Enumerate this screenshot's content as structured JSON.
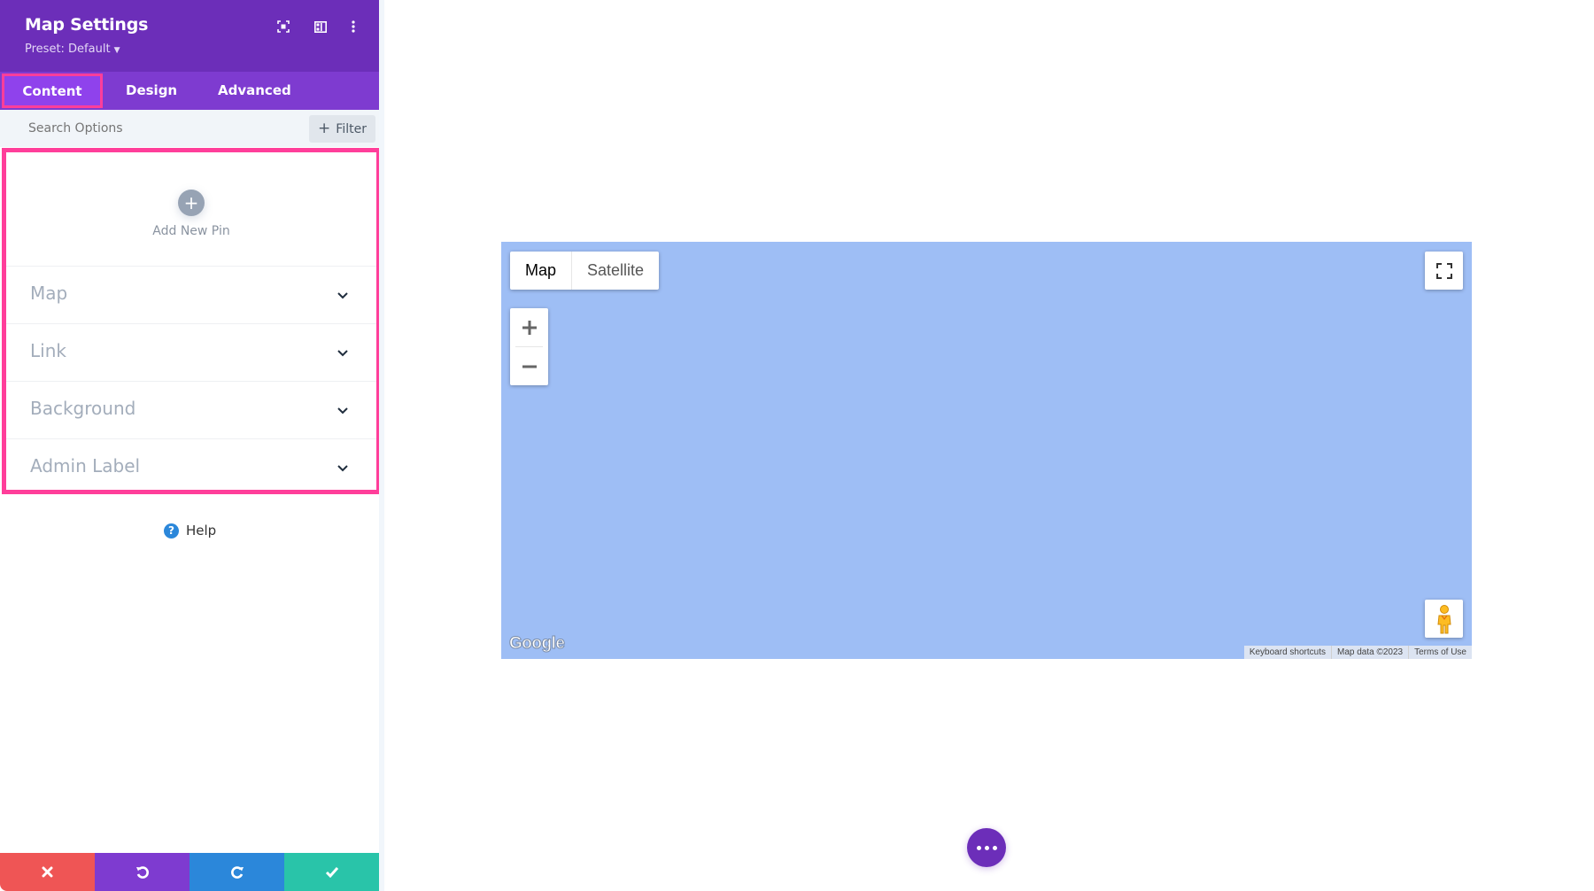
{
  "panel": {
    "title": "Map Settings",
    "preset": "Preset: Default",
    "header_icons": [
      "focus-icon",
      "split-view-icon",
      "more-vertical-icon"
    ],
    "tabs": [
      {
        "label": "Content",
        "active": true
      },
      {
        "label": "Design",
        "active": false
      },
      {
        "label": "Advanced",
        "active": false
      }
    ],
    "search": {
      "placeholder": "Search Options",
      "value": ""
    },
    "filter_label": "Filter",
    "add_pin_label": "Add New Pin",
    "sections": [
      {
        "label": "Map"
      },
      {
        "label": "Link"
      },
      {
        "label": "Background"
      },
      {
        "label": "Admin Label"
      }
    ],
    "help_label": "Help",
    "actions": [
      "cancel",
      "undo",
      "redo",
      "save"
    ]
  },
  "map": {
    "map_type_buttons": [
      {
        "label": "Map",
        "active": true
      },
      {
        "label": "Satellite",
        "active": false
      }
    ],
    "logo": "Google",
    "attribution": [
      "Keyboard shortcuts",
      "Map data ©2023",
      "Terms of Use"
    ],
    "water_color": "#9ebef5"
  },
  "colors": {
    "header": "#6c2eb9",
    "tabs": "#7e3bd0",
    "highlight": "#ff3e9a",
    "cancel": "#ef5555",
    "undo": "#7e3bd0",
    "redo": "#2b87da",
    "save": "#29c4a9"
  }
}
